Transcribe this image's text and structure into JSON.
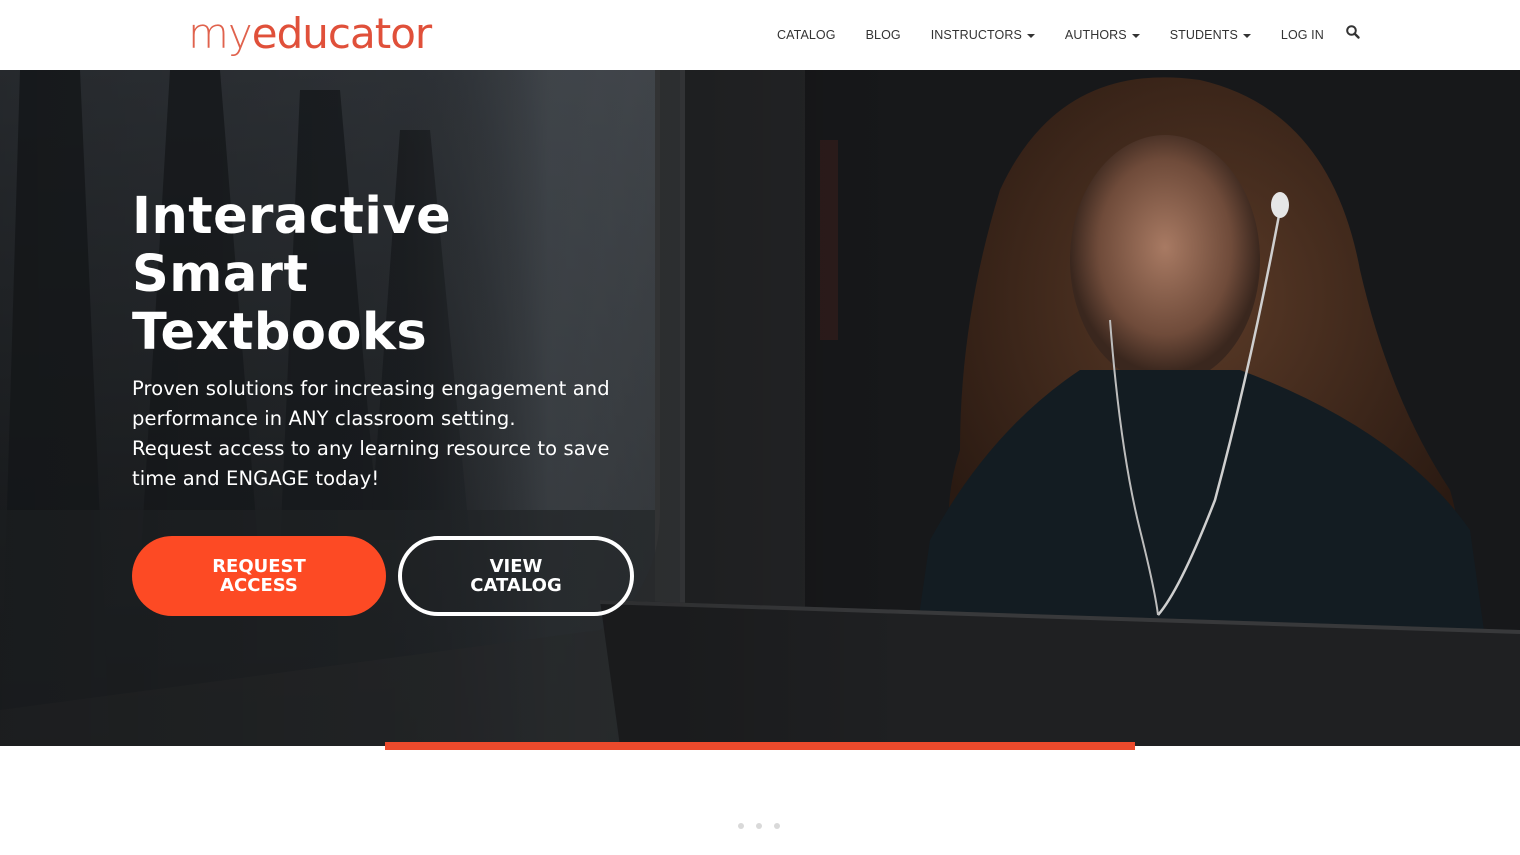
{
  "brand": {
    "logo_prefix": "my",
    "logo_suffix": "educator",
    "accent_color": "#fd4a24"
  },
  "nav": {
    "items": [
      {
        "label": "CATALOG",
        "has_dropdown": false
      },
      {
        "label": "BLOG",
        "has_dropdown": false
      },
      {
        "label": "INSTRUCTORS",
        "has_dropdown": true
      },
      {
        "label": "AUTHORS",
        "has_dropdown": true
      },
      {
        "label": "STUDENTS",
        "has_dropdown": true
      },
      {
        "label": "LOG IN",
        "has_dropdown": false
      }
    ],
    "search_icon": "search-icon"
  },
  "hero": {
    "title_lines": [
      "Interactive",
      "Smart",
      "Textbooks"
    ],
    "subtitle_lines": [
      "Proven solutions for increasing engagement and",
      "performance in ANY classroom setting.",
      "Request access to any learning resource to save",
      "time and ENGAGE today!"
    ],
    "primary_button": {
      "line1": "REQUEST",
      "line2": "ACCESS"
    },
    "secondary_button": {
      "line1": "VIEW",
      "line2": "CATALOG"
    },
    "image_description": "woman with earphones looking out of a train window"
  },
  "carousel": {
    "dots": 3
  }
}
